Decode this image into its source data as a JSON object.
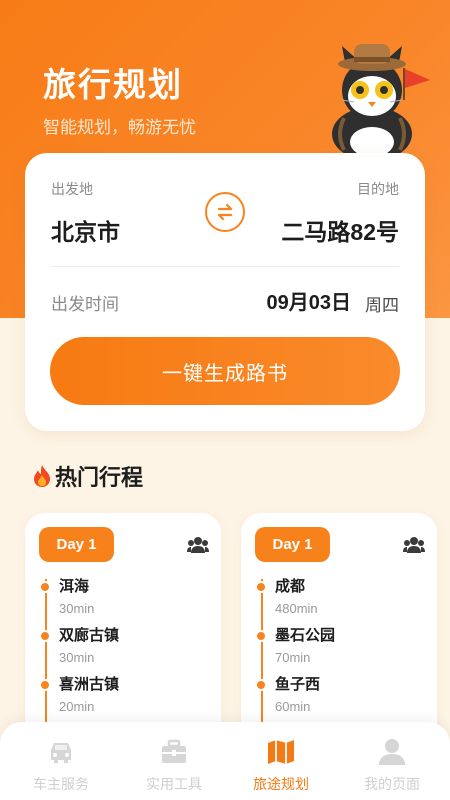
{
  "header": {
    "title": "旅行规划",
    "subtitle": "智能规划，畅游无忧"
  },
  "planner": {
    "from_label": "出发地",
    "to_label": "目的地",
    "from_value": "北京市",
    "to_value": "二马路82号",
    "time_label": "出发时间",
    "date_value": "09月03日",
    "weekday": "周四",
    "generate_button": "一键生成路书"
  },
  "hot": {
    "title": "热门行程",
    "trips": [
      {
        "day": "Day 1",
        "stops": [
          {
            "name": "洱海",
            "duration": "30min"
          },
          {
            "name": "双廊古镇",
            "duration": "30min"
          },
          {
            "name": "喜洲古镇",
            "duration": "20min"
          }
        ]
      },
      {
        "day": "Day 1",
        "stops": [
          {
            "name": "成都",
            "duration": "480min"
          },
          {
            "name": "墨石公园",
            "duration": "70min"
          },
          {
            "name": "鱼子西",
            "duration": "60min"
          }
        ]
      }
    ]
  },
  "tabbar": {
    "items": [
      {
        "label": "车主服务",
        "icon": "car-icon"
      },
      {
        "label": "实用工具",
        "icon": "toolbox-icon"
      },
      {
        "label": "旅途规划",
        "icon": "map-icon"
      },
      {
        "label": "我的页面",
        "icon": "user-icon"
      }
    ],
    "active_index": 2
  },
  "colors": {
    "accent": "#f7841f",
    "background": "#fdf4e6",
    "inactive": "#cfcfcf"
  }
}
